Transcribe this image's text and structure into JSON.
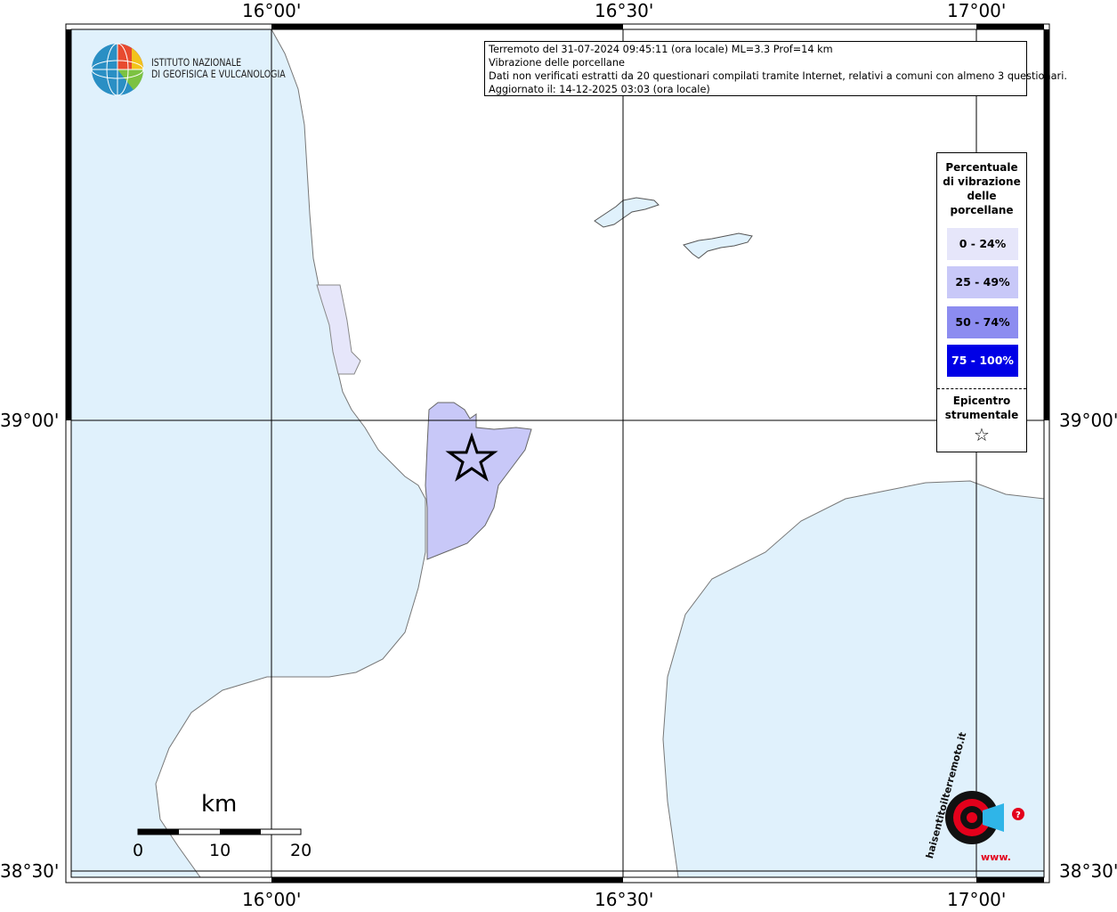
{
  "info": {
    "line1": "Terremoto del 31-07-2024 09:45:11 (ora locale) ML=3.3 Prof=14 km",
    "line2": "Vibrazione delle porcellane",
    "line3": "Dati non verificati estratti da 20 questionari compilati tramite Internet, relativi a comuni con almeno 3 questionari.",
    "line4": "Aggiornato il: 14-12-2025 03:03 (ora locale)"
  },
  "longitude_labels": [
    "16°00'",
    "16°30'",
    "17°00'"
  ],
  "latitude_labels": [
    "39°00'",
    "38°30'"
  ],
  "legend": {
    "title_lines": [
      "Percentuale",
      "di vibrazione",
      "delle",
      "porcellane"
    ],
    "classes": [
      {
        "label": "0 - 24%",
        "color": "#e6e6fa",
        "text_color": "#000000"
      },
      {
        "label": "25 - 49%",
        "color": "#c8c8f8",
        "text_color": "#000000"
      },
      {
        "label": "50 - 74%",
        "color": "#8c8cf0",
        "text_color": "#000000"
      },
      {
        "label": "75 - 100%",
        "color": "#0000e6",
        "text_color": "#ffffff"
      }
    ],
    "epicenter_lines": [
      "Epicentro",
      "strumentale"
    ],
    "epicenter_symbol": "☆"
  },
  "institute": {
    "line1": "ISTITUTO NAZIONALE",
    "line2": "DI GEOFISICA E VULCANOLOGIA"
  },
  "scale_bar": {
    "unit": "km",
    "ticks": [
      "0",
      "10",
      "20"
    ]
  },
  "hst_logo": {
    "text": "haisentitoilterremoto.it",
    "url_text": "www."
  },
  "colors": {
    "sea": "#e0f1fc",
    "land": "#ffffff",
    "borders": "#b4b4b4",
    "affected_light": "#e6e6fa",
    "affected_mid": "#c8c8f8"
  }
}
